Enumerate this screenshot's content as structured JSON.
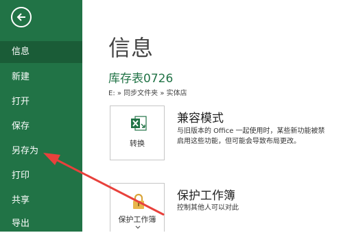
{
  "sidebar": {
    "back_icon": "back-arrow-icon",
    "items": [
      {
        "label": "信息",
        "active": true
      },
      {
        "label": "新建"
      },
      {
        "label": "打开"
      },
      {
        "label": "保存"
      },
      {
        "label": "另存为"
      },
      {
        "label": "打印"
      },
      {
        "label": "共享"
      },
      {
        "label": "导出"
      }
    ]
  },
  "main": {
    "page_title": "信息",
    "doc_title": "库存表0726",
    "doc_path": "E: » 同步文件夹 » 实体店",
    "compat": {
      "button_label": "转换",
      "icon": "excel-convert-icon",
      "title": "兼容模式",
      "desc_line1": "与旧版本的 Office 一起使用时，某些新功能被禁",
      "desc_line2": "启用这些功能，但可能会导致布局更改。"
    },
    "protect": {
      "button_label": "保护工作簿",
      "icon": "lock-icon",
      "title": "保护工作簿",
      "desc_line1": "控制其他人可以对此"
    }
  },
  "colors": {
    "sidebar": "#217346",
    "sidebar_active": "#1a5c37",
    "annotation_arrow": "#e8413c"
  }
}
